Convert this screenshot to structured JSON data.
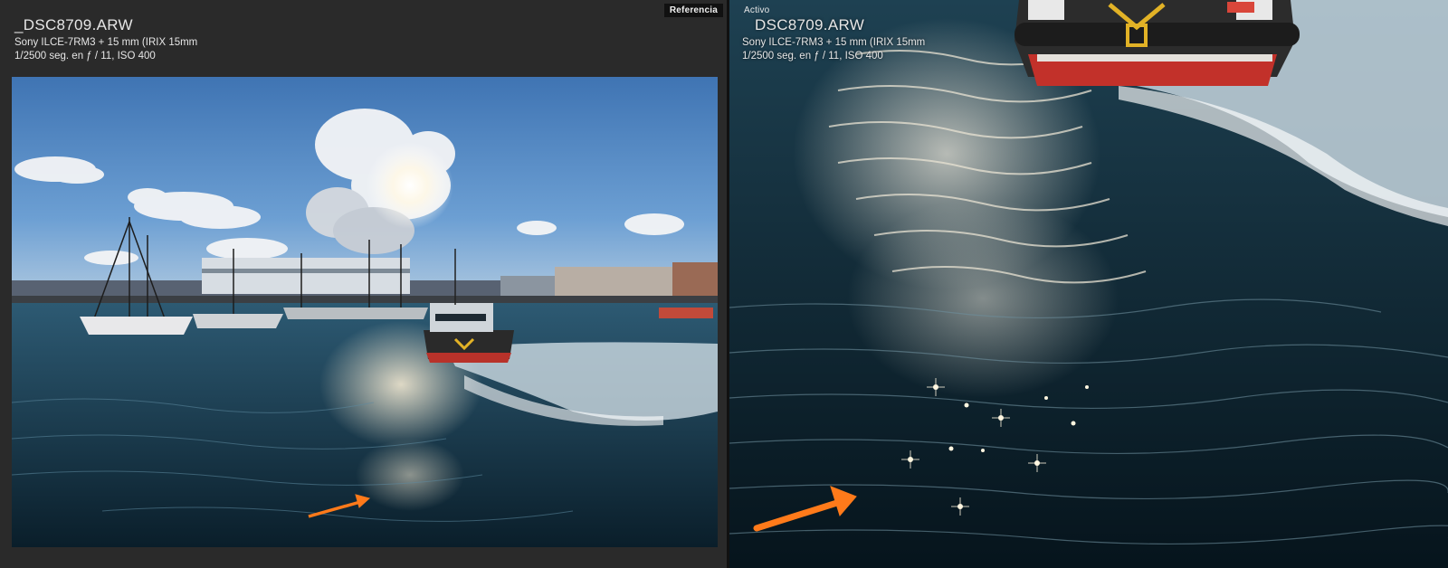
{
  "reference_pane": {
    "tag": "Referencia",
    "filename": "_DSC8709.ARW",
    "camera": "Sony ILCE-7RM3 + 15 mm (IRIX 15mm",
    "exposure": "1/2500 seg. en ƒ / 11, ISO 400"
  },
  "active_pane": {
    "tag": "Activo",
    "filename": "DSC8709.ARW",
    "camera": "Sony ILCE-7RM3 + 15 mm (IRIX 15mm",
    "exposure": "1/2500 seg. en ƒ / 11, ISO 400"
  },
  "colors": {
    "panel_bg": "#2a2a2a",
    "arrow": "#ff7a1a",
    "water": "#0e2a38",
    "sky": "#4f86c4"
  }
}
